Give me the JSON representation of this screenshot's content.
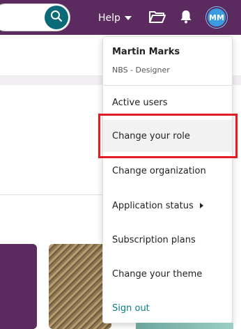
{
  "header": {
    "search": {
      "placeholder": "",
      "value": ""
    },
    "help_label": "Help",
    "avatar_initials": "MM"
  },
  "user_menu": {
    "name": "Martin Marks",
    "role": "NBS - Designer",
    "items": [
      {
        "label": "Active users",
        "has_submenu": false,
        "state": "normal"
      },
      {
        "label": "Change your role",
        "has_submenu": false,
        "state": "hover",
        "highlighted": true
      },
      {
        "label": "Change organization",
        "has_submenu": false,
        "state": "normal"
      },
      {
        "label": "Application status",
        "has_submenu": true,
        "state": "normal"
      },
      {
        "label": "Subscription plans",
        "has_submenu": false,
        "state": "normal"
      },
      {
        "label": "Change your theme",
        "has_submenu": false,
        "state": "normal"
      },
      {
        "label": "Sign out",
        "has_submenu": false,
        "state": "link"
      }
    ]
  },
  "icons": [
    "search-icon",
    "caret-down-icon",
    "folder-icon",
    "bell-icon",
    "chevron-right-icon"
  ],
  "colors": {
    "header_bg": "#5b2a5f",
    "search_button": "#0b6a78",
    "avatar_bg": "#3a9be0",
    "link": "#0b7a8a",
    "highlight_border": "#e31b23"
  }
}
